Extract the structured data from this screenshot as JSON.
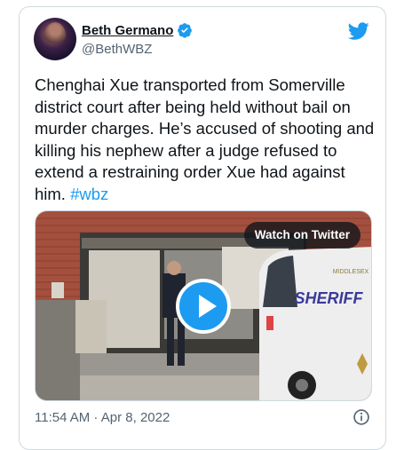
{
  "author": {
    "name": "Beth Germano",
    "handle": "@BethWBZ",
    "verified_icon": "verified-badge-icon",
    "avatar_icon": "avatar"
  },
  "brand": {
    "icon": "twitter-bird-icon",
    "color": "#1d9bf0"
  },
  "tweet": {
    "body": "Chenghai Xue transported from Somerville district court after being held without bail on murder charges. He’s accused of shooting and killing his nephew after a judge refused to extend a restraining order Xue had against him.",
    "hashtag": "#wbz"
  },
  "media": {
    "watch_label": "Watch on Twitter",
    "play_icon": "play-icon",
    "van_lettering": "SHERIFF",
    "van_county": "MIDDLESEX"
  },
  "footer": {
    "timestamp": "11:54 AM · Apr 8, 2022",
    "info_icon": "info-icon"
  },
  "colors": {
    "text": "#0f1419",
    "muted": "#536471",
    "accent": "#1d9bf0",
    "border": "#cfd9de"
  }
}
